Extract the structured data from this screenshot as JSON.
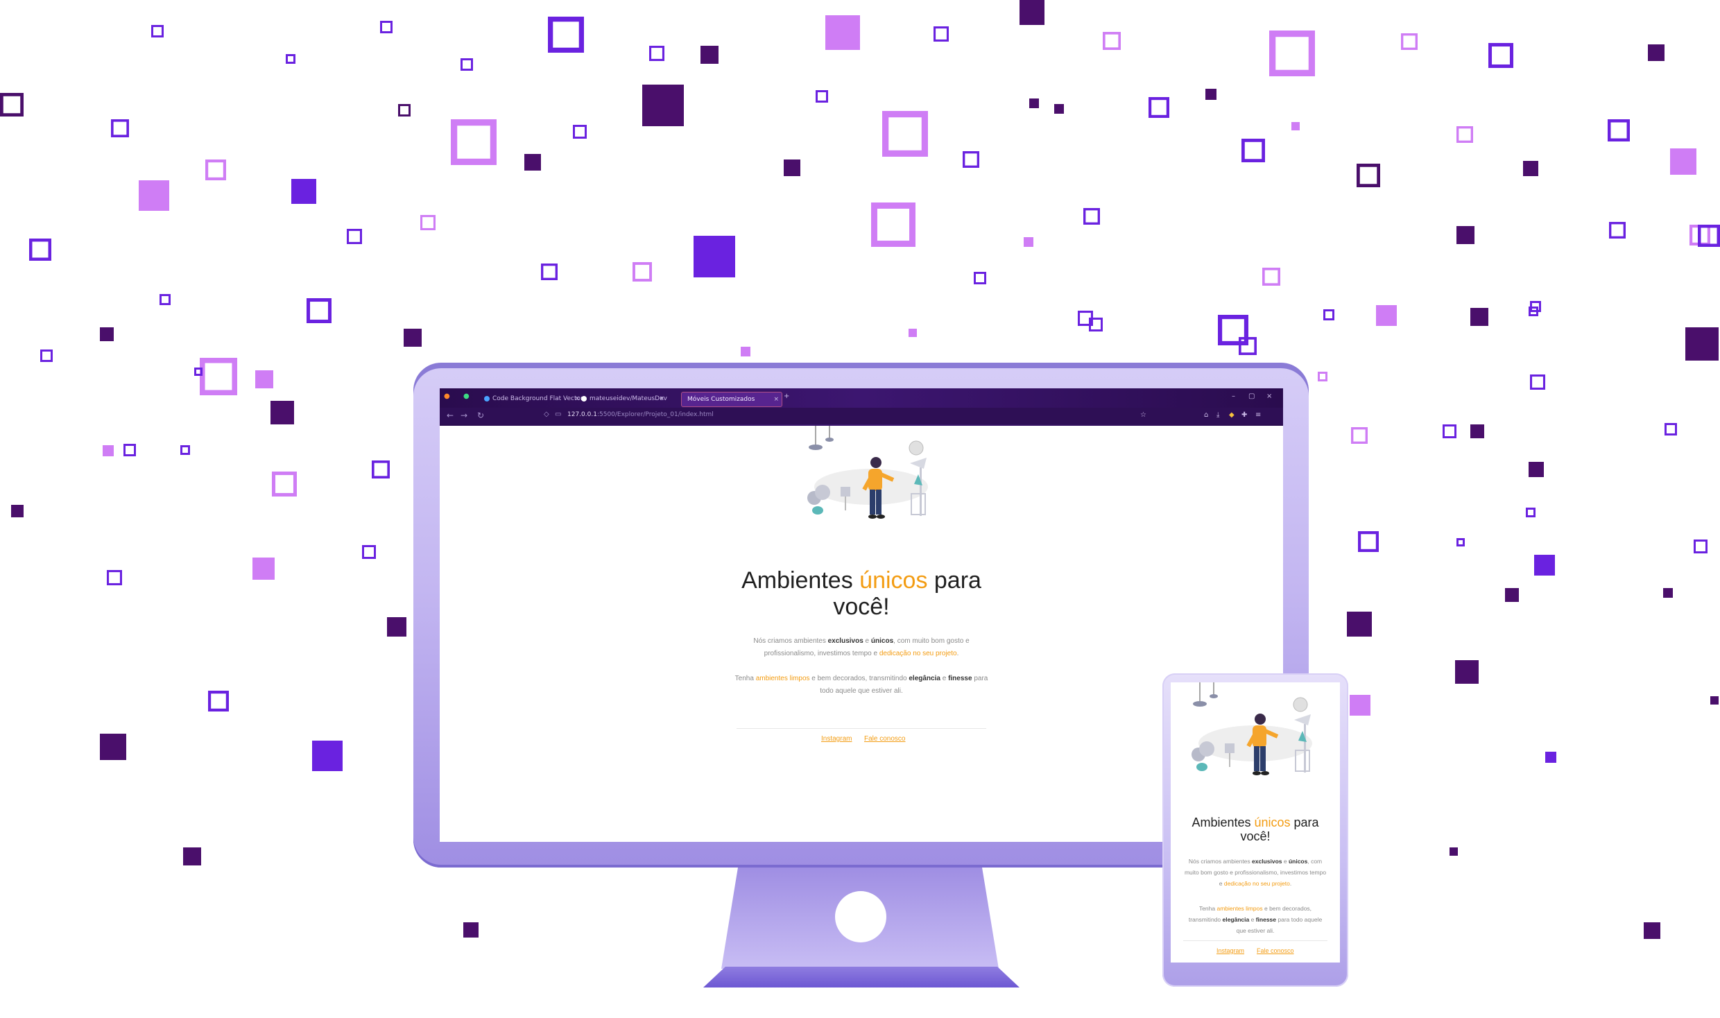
{
  "browser": {
    "tabs": [
      {
        "label": "Code Background Flat Vector..."
      },
      {
        "label": "mateuseidev/MateusDev"
      },
      {
        "label": "Móveis Customizados"
      }
    ],
    "new_tab_label": "+",
    "url_host": "127.0.0.1",
    "url_path": ":5500/Explorer/Projeto_01/index.html"
  },
  "hero": {
    "title_before": "Ambientes ",
    "title_accent": "únicos",
    "title_after": " para você!"
  },
  "paragraph1": {
    "a": "Nós criamos ambientes ",
    "b": "exclusivos",
    "c": " e ",
    "d": "únicos",
    "e": ", com muito bom gosto e profissionalismo, investimos tempo e ",
    "f": "dedicação no seu projeto",
    "g": "."
  },
  "paragraph2": {
    "a": "Tenha ",
    "b": "ambientes limpos",
    "c": " e bem decorados, transmitindo ",
    "d": "elegância",
    "e": " e ",
    "f": "finesse",
    "g": " para todo aquele que estiver ali."
  },
  "footer": {
    "instagram": "Instagram",
    "contact": "Fale conosco"
  },
  "colors": {
    "accent": "#f39c12",
    "purple_dark": "#4a0f6b",
    "purple_mid": "#6a22e0",
    "purple_light": "#cf7df5"
  }
}
